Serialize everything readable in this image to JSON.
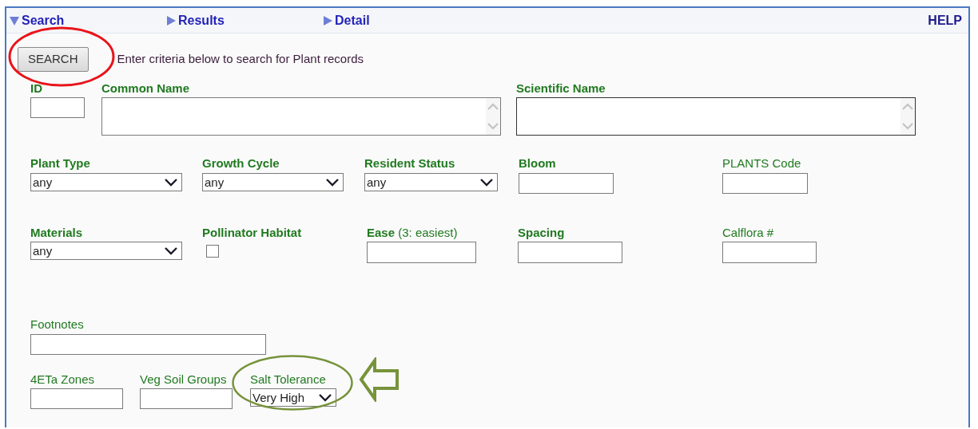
{
  "tabs": [
    {
      "label": "Search",
      "selected": true
    },
    {
      "label": "Results",
      "selected": false
    },
    {
      "label": "Detail",
      "selected": false
    }
  ],
  "help_link": "HELP",
  "search_button": {
    "label": "SEARCH",
    "highlight": {
      "color": "#e8141a"
    }
  },
  "instructions": "Enter criteria below to search for Plant records",
  "rows": [
    {
      "fields": [
        {
          "label": "ID",
          "emphasized": true,
          "kind": "text"
        },
        {
          "label": "Common Name",
          "emphasized": true,
          "kind": "textarea"
        },
        {
          "label": "Scientific Name",
          "emphasized": true,
          "kind": "textarea",
          "focused": true
        }
      ]
    },
    {
      "fields": [
        {
          "label": "Plant Type",
          "emphasized": true,
          "kind": "select",
          "value": "any"
        },
        {
          "label": "Growth Cycle",
          "emphasized": true,
          "kind": "select",
          "value": "any"
        },
        {
          "label": "Resident Status",
          "emphasized": true,
          "kind": "select",
          "value": "any"
        },
        {
          "label": "Bloom",
          "emphasized": true,
          "kind": "text"
        },
        {
          "label": "PLANTS Code",
          "emphasized": false,
          "kind": "text"
        }
      ]
    },
    {
      "fields": [
        {
          "label": "Materials",
          "emphasized": true,
          "kind": "select",
          "value": "any"
        },
        {
          "label": "Pollinator Habitat",
          "emphasized": true,
          "kind": "checkbox",
          "checked": false
        },
        {
          "label": "Ease",
          "note": "(3: easiest)",
          "emphasized": true,
          "kind": "text"
        },
        {
          "label": "Spacing",
          "emphasized": true,
          "kind": "text"
        },
        {
          "label": "Calflora #",
          "emphasized": false,
          "kind": "text"
        }
      ]
    },
    {
      "fields": [
        {
          "label": "Footnotes",
          "emphasized": false,
          "kind": "text"
        }
      ]
    },
    {
      "fields": [
        {
          "label": "4ETa Zones",
          "emphasized": false,
          "kind": "text"
        },
        {
          "label": "Veg Soil Groups",
          "emphasized": false,
          "kind": "text"
        },
        {
          "label": "Salt Tolerance",
          "emphasized": false,
          "kind": "select",
          "value": "Very High",
          "highlight": {
            "color": "#77933c",
            "arrow": true
          }
        }
      ]
    }
  ]
}
